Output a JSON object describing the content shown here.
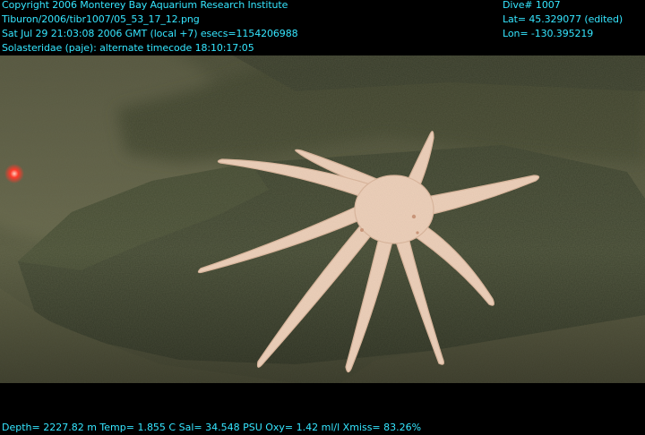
{
  "overlay": {
    "top_left": [
      "Copyright 2006 Monterey Bay Aquarium Research Institute",
      "Tiburon/2006/tibr1007/05_53_17_12.png",
      "Sat Jul 29 21:03:08 2006 GMT (local +7)  esecs=1154206988",
      "Solasteridae (paje): alternate timecode 18:10:17:05"
    ],
    "top_right": [
      "Dive# 1007",
      "Lat= 45.329077 (edited)",
      "Lon= -130.395219"
    ],
    "bottom": "Depth= 2227.82 m  Temp= 1.855 C  Sal= 34.548 PSU  Oxy= 1.42 ml/l  Xmiss= 83.26%"
  },
  "colors": {
    "overlay_text": "#35e6ff",
    "background": "#000000",
    "seafloor": "#4e5236",
    "rock": "#3f4530",
    "seastar": "#f1d4bd",
    "laser": "#ff3a2a"
  }
}
